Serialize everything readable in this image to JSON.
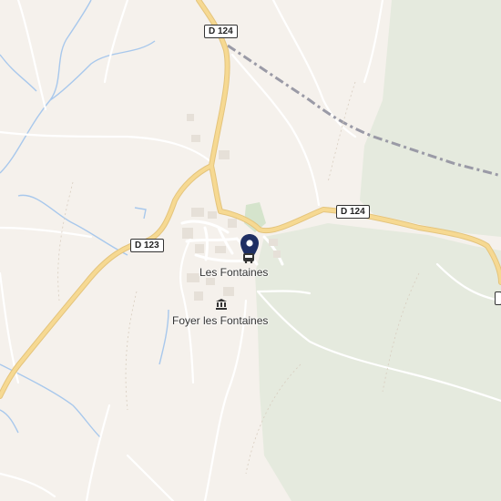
{
  "map": {
    "places": {
      "village": "Les Fontaines",
      "poi": "Foyer les Fontaines"
    },
    "roads": {
      "d124_north": "D 124",
      "d124_east": "D 124",
      "d123": "D 123"
    },
    "icons": {
      "pin": "location-pin-icon",
      "bus": "bus-stop-icon",
      "museum": "museum-icon"
    },
    "colors": {
      "background": "#f5f1ec",
      "forest": "#e3e9dc",
      "main_road": "#f3d58c",
      "stream": "#a8c8ec",
      "rail": "#9a9aa6",
      "pin": "#1f2f63"
    }
  }
}
